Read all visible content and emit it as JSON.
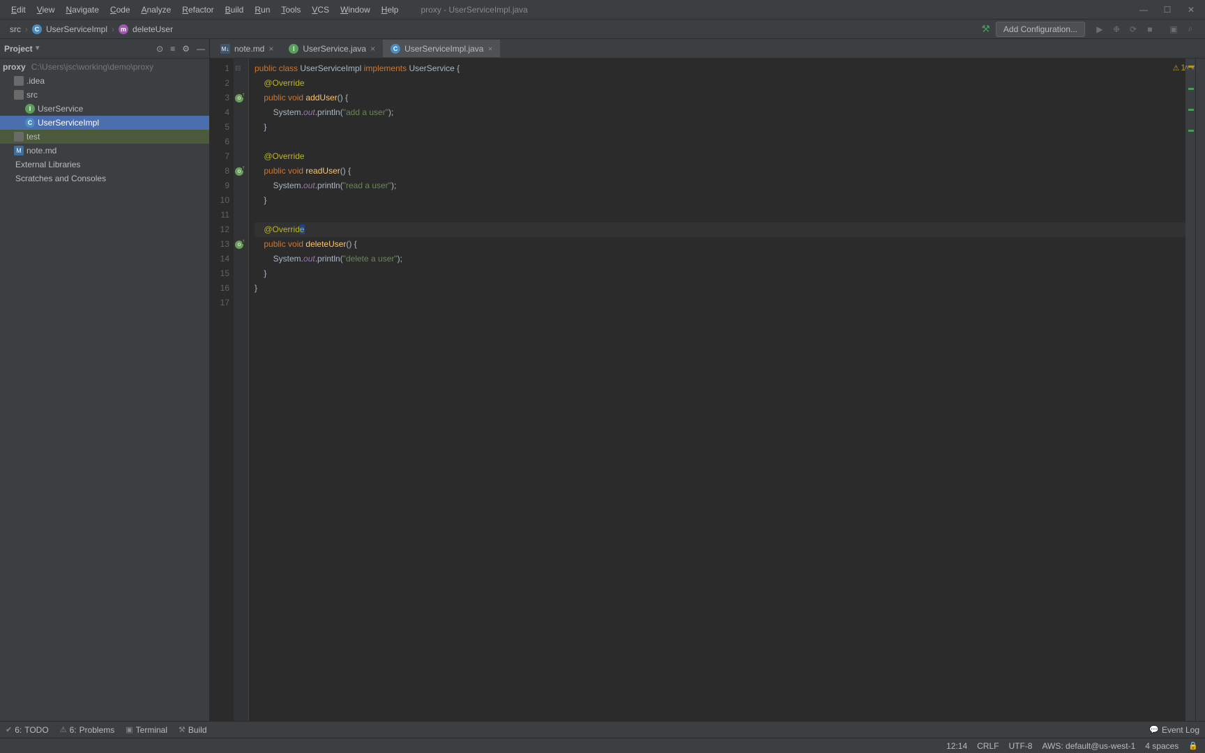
{
  "title": "proxy - UserServiceImpl.java",
  "menu": [
    "Edit",
    "View",
    "Navigate",
    "Code",
    "Analyze",
    "Refactor",
    "Build",
    "Run",
    "Tools",
    "VCS",
    "Window",
    "Help"
  ],
  "breadcrumbs": [
    {
      "label": "src",
      "icon": "folder"
    },
    {
      "label": "UserServiceImpl",
      "icon": "class"
    },
    {
      "label": "deleteUser",
      "icon": "method"
    }
  ],
  "run_config_label": "Add Configuration...",
  "project": {
    "header": "Project",
    "root": {
      "name": "proxy",
      "path": "C:\\Users\\jsc\\working\\demo\\proxy"
    },
    "nodes": [
      {
        "name": ".idea",
        "type": "folder",
        "indent": 1
      },
      {
        "name": "src",
        "type": "folder",
        "indent": 1,
        "cursor": true
      },
      {
        "name": "UserService",
        "type": "interface",
        "indent": 2
      },
      {
        "name": "UserServiceImpl",
        "type": "class",
        "indent": 2,
        "selected": true
      },
      {
        "name": "test",
        "type": "folder",
        "indent": 1,
        "highlight": true
      },
      {
        "name": "note.md",
        "type": "md",
        "indent": 1
      },
      {
        "name": "External Libraries",
        "type": "lib",
        "indent": 0
      },
      {
        "name": "Scratches and Consoles",
        "type": "scratches",
        "indent": 0
      }
    ]
  },
  "tabs": [
    {
      "label": "note.md",
      "icon": "md",
      "active": false
    },
    {
      "label": "UserService.java",
      "icon": "interface",
      "active": false
    },
    {
      "label": "UserServiceImpl.java",
      "icon": "class",
      "active": true
    }
  ],
  "code_lines": [
    {
      "n": 1,
      "html": "<span class='kw'>public class</span> <span class='cls'>UserServiceImpl</span> <span class='kw'>implements</span> <span class='cls'>UserService</span> <span class='pln'>{</span>"
    },
    {
      "n": 2,
      "html": "    <span class='ann'>@Override</span>"
    },
    {
      "n": 3,
      "mark": "override",
      "html": "    <span class='kw'>public void</span> <span class='mth'>addUser</span><span class='pln'>() {</span>"
    },
    {
      "n": 4,
      "html": "        <span class='pln'>System.</span><span class='fld'>out</span><span class='pln'>.println(</span><span class='str'>\"add a user\"</span><span class='pln'>);</span>"
    },
    {
      "n": 5,
      "html": "    <span class='pln'>}</span>"
    },
    {
      "n": 6,
      "html": ""
    },
    {
      "n": 7,
      "html": "    <span class='ann'>@Override</span>"
    },
    {
      "n": 8,
      "mark": "override",
      "html": "    <span class='kw'>public void</span> <span class='mth'>readUser</span><span class='pln'>() {</span>"
    },
    {
      "n": 9,
      "html": "        <span class='pln'>System.</span><span class='fld'>out</span><span class='pln'>.println(</span><span class='str'>\"read a user\"</span><span class='pln'>);</span>"
    },
    {
      "n": 10,
      "html": "    <span class='pln'>}</span>"
    },
    {
      "n": 11,
      "html": ""
    },
    {
      "n": 12,
      "caret": true,
      "html": "    <span class='ann'>@Overrid</span><span class='ann ann-caret'>e</span>"
    },
    {
      "n": 13,
      "mark": "override",
      "html": "    <span class='kw'>public void</span> <span class='mth'>deleteUser</span><span class='pln'>() {</span>"
    },
    {
      "n": 14,
      "html": "        <span class='pln'>System.</span><span class='fld'>out</span><span class='pln'>.println(</span><span class='str'>\"delete a user\"</span><span class='pln'>);</span>"
    },
    {
      "n": 15,
      "html": "    <span class='pln'>}</span>"
    },
    {
      "n": 16,
      "html": "<span class='pln'>}</span>"
    },
    {
      "n": 17,
      "html": ""
    }
  ],
  "inspection": {
    "warn_count": "1"
  },
  "bottom_tools": [
    {
      "label": "TODO",
      "shortcut": "6:"
    },
    {
      "label": "Problems",
      "shortcut": "6:"
    },
    {
      "label": "Terminal",
      "shortcut": ""
    },
    {
      "label": "Build",
      "shortcut": ""
    }
  ],
  "event_log": "Event Log",
  "status": {
    "pos": "12:14",
    "linesep": "CRLF",
    "encoding": "UTF-8",
    "aws": "AWS: default@us-west-1",
    "indent": "4 spaces"
  }
}
